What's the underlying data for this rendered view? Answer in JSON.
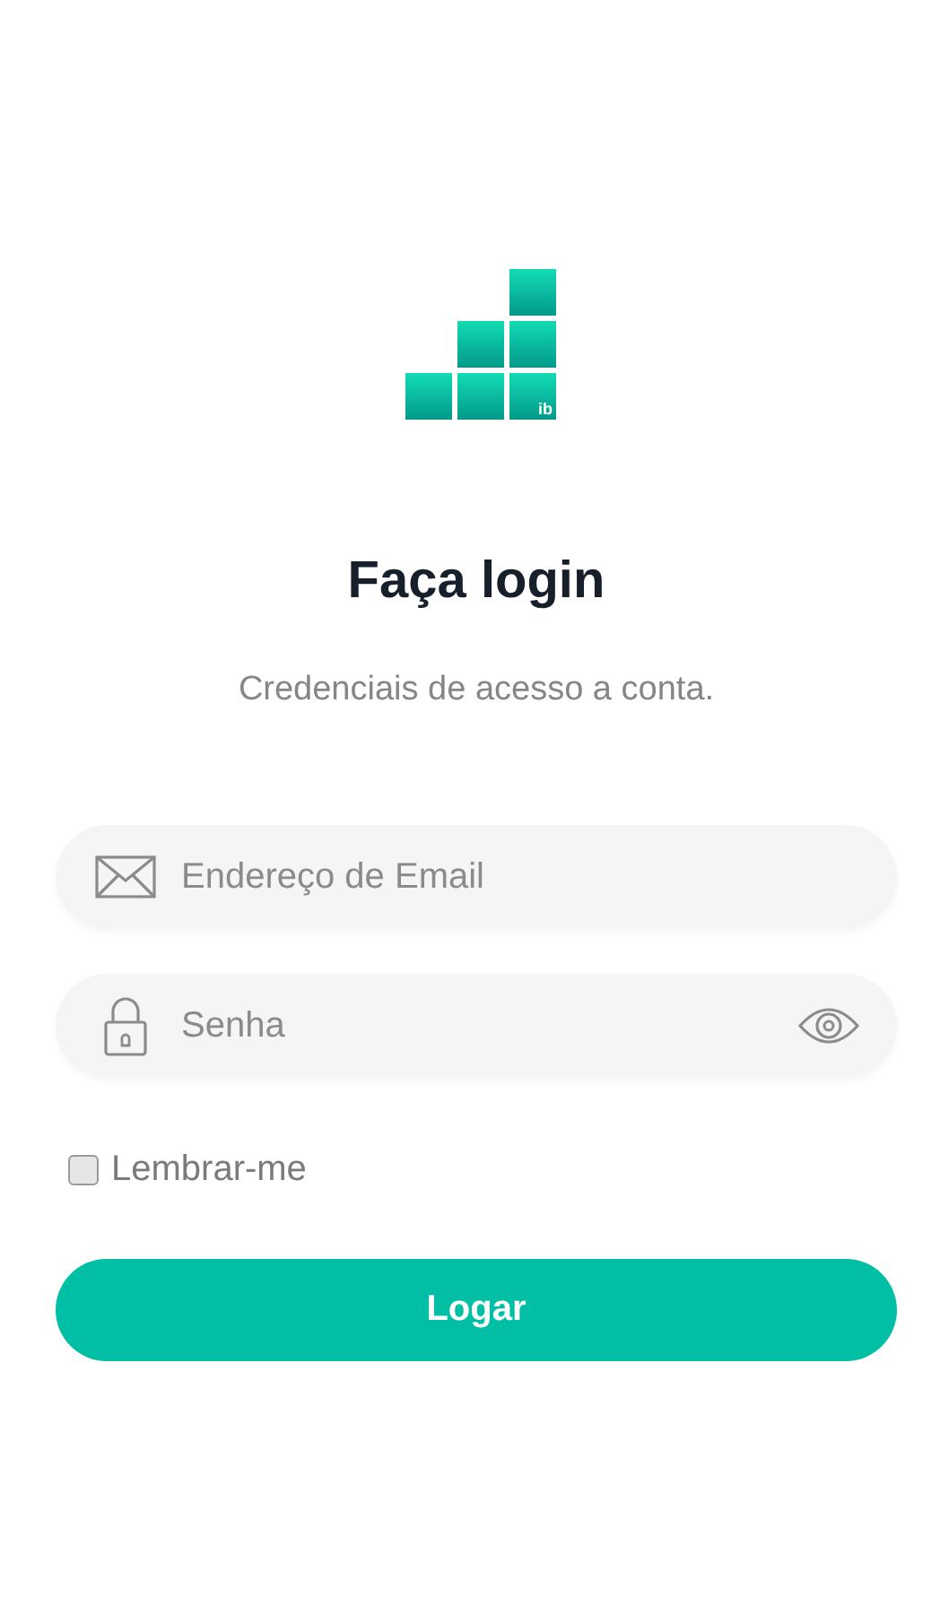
{
  "logo": {
    "text": "ib"
  },
  "title": "Faça login",
  "subtitle": "Credenciais de acesso a conta.",
  "fields": [
    {
      "kind": "email",
      "placeholder": "Endereço de Email"
    },
    {
      "kind": "password",
      "placeholder": "Senha"
    }
  ],
  "remember": {
    "label": "Lembrar-me",
    "checked": false
  },
  "submit": "Logar"
}
